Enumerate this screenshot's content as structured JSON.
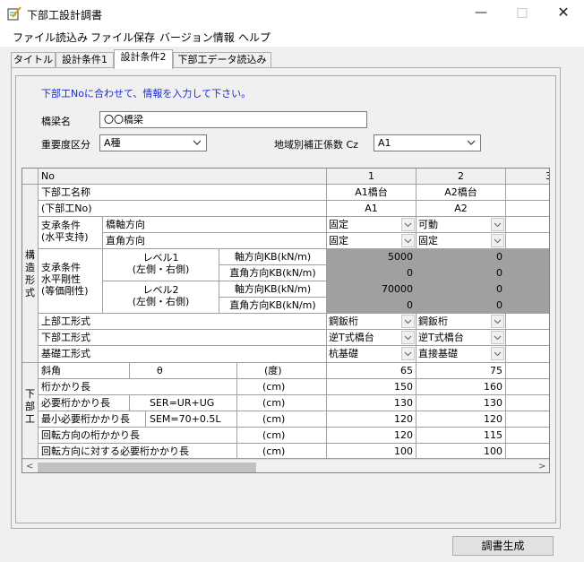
{
  "window": {
    "title": "下部工設計調書",
    "min": "—",
    "max": "□",
    "close": "✕"
  },
  "menu": [
    "ファイル読込み",
    "ファイル保存",
    "バージョン情報",
    "ヘルプ"
  ],
  "tabs": [
    "タイトル",
    "設計条件1",
    "設計条件2",
    "下部工データ読込み"
  ],
  "active_tab": 2,
  "notice": "下部工Noに合わせて、情報を入力して下さい。",
  "form": {
    "bridge_name_label": "橋梁名",
    "bridge_name_value": "〇〇橋梁",
    "importance_label": "重要度区分",
    "importance_value": "A種",
    "region_label": "地域別補正係数 Cz",
    "region_value": "A1"
  },
  "grid": {
    "no_label": "No",
    "group1": "構造形式",
    "group2": "下部工",
    "pier_name": "下部工名称",
    "pier_no": "(下部工No)",
    "bearing1": "支承条件",
    "bearing2": "(水平支持)",
    "dir_bridge": "橋軸方向",
    "dir_perp": "直角方向",
    "stiff1": "支承条件",
    "stiff2": "水平剛性",
    "stiff3": "(等価剛性)",
    "lv1a": "レベル1",
    "lv1b": "(左側・右側)",
    "lv2a": "レベル2",
    "lv2b": "(左側・右側)",
    "kb_axis": "軸方向KB(kN/m)",
    "kb_perp": "直角方向KB(kN/m)",
    "super_type": "上部工形式",
    "sub_type": "下部工形式",
    "found_type": "基礎工形式",
    "skew": "斜角",
    "theta": "θ",
    "unit_deg": "(度)",
    "seat": "桁かかり長",
    "req_seat": "必要桁かかり長",
    "req_formula": "SER=UR+UG",
    "min_seat": "最小必要桁かかり長",
    "min_formula": "SEM=70+0.5L",
    "rot_seat": "回転方向の桁かかり長",
    "rot_req": "回転方向に対する必要桁かかり長",
    "unit_cm": "(cm)",
    "col3_partial": "3",
    "columns": [
      {
        "no": "1",
        "name": "A1橋台",
        "id": "A1",
        "bearing_axis": "固定",
        "bearing_perp": "固定",
        "kb1_axis": "5000",
        "kb1_perp": "0",
        "kb2_axis": "70000",
        "kb2_perp": "0",
        "super": "鋼鈑桁",
        "sub": "逆T式橋台",
        "found": "杭基礎",
        "skew": "65",
        "seat": "150",
        "req": "130",
        "min": "120",
        "rot": "120",
        "rotreq": "100"
      },
      {
        "no": "2",
        "name": "A2橋台",
        "id": "A2",
        "bearing_axis": "可動",
        "bearing_perp": "固定",
        "kb1_axis": "0",
        "kb1_perp": "0",
        "kb2_axis": "0",
        "kb2_perp": "0",
        "super": "鋼鈑桁",
        "sub": "逆T式橋台",
        "found": "直接基礎",
        "skew": "75",
        "seat": "160",
        "req": "130",
        "min": "120",
        "rot": "115",
        "rotreq": "100"
      }
    ]
  },
  "scroll": {
    "left": "<",
    "right": ">"
  },
  "generate_button": "調書生成"
}
